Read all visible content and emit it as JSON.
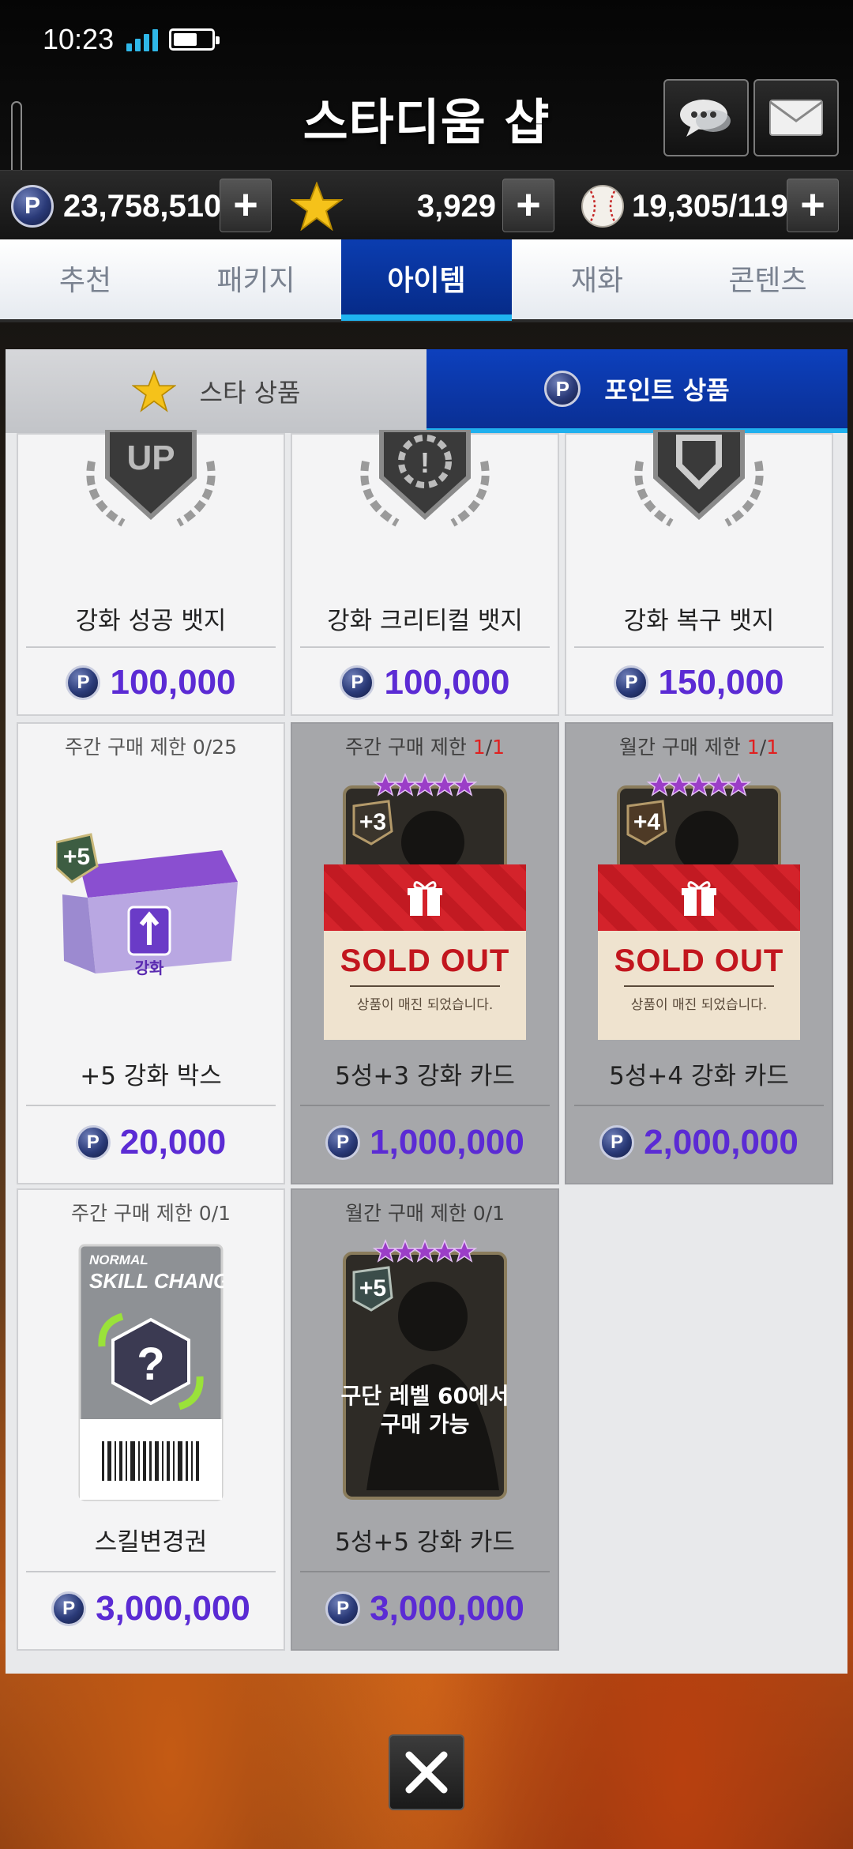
{
  "status_bar": {
    "time": "10:23"
  },
  "header": {
    "title": "스타디움 샵"
  },
  "currency": {
    "points": "23,758,510",
    "stars": "3,929",
    "baseballs": "19,305/119",
    "coin_symbol": "P"
  },
  "main_tabs": [
    {
      "label": "추천"
    },
    {
      "label": "패키지"
    },
    {
      "label": "아이템"
    },
    {
      "label": "재화"
    },
    {
      "label": "콘텐츠"
    }
  ],
  "sub_tabs": [
    {
      "label": "스타 상품"
    },
    {
      "label": "포인트 상품"
    }
  ],
  "items": [
    {
      "limit": "",
      "name": "강화 성공 뱃지",
      "price": "100,000",
      "art_label": "UP"
    },
    {
      "limit": "",
      "name": "강화 크리티컬 뱃지",
      "price": "100,000",
      "art_label": "!"
    },
    {
      "limit": "",
      "name": "강화 복구 뱃지",
      "price": "150,000",
      "art_label": ""
    },
    {
      "limit": "주간 구매 제한 0/25",
      "name": "+5 강화 박스",
      "price": "20,000",
      "art_label": "+5",
      "art_sub": "강화"
    },
    {
      "limit_prefix": "주간 구매 제한 ",
      "limit_a": "1",
      "limit_b": "1",
      "name": "5성+3 강화 카드",
      "price": "1,000,000",
      "art_label": "+3",
      "sold_title": "SOLD OUT",
      "sold_desc": "상품이 매진 되었습니다."
    },
    {
      "limit_prefix": "월간 구매 제한 ",
      "limit_a": "1",
      "limit_b": "1",
      "name": "5성+4 강화 카드",
      "price": "2,000,000",
      "art_label": "+4",
      "sold_title": "SOLD OUT",
      "sold_desc": "상품이 매진 되었습니다."
    },
    {
      "limit": "주간 구매 제한 0/1",
      "name": "스킬변경권",
      "price": "3,000,000",
      "art_top1": "NORMAL",
      "art_top2": "SKILL CHANGE",
      "art_q": "?"
    },
    {
      "limit": "월간 구매 제한 0/1",
      "name": "5성+5 강화 카드",
      "price": "3,000,000",
      "art_label": "+5",
      "lock_text_1": "구단 레벨 60에서",
      "lock_text_2": "구매 가능"
    }
  ],
  "colors": {
    "accent_blue": "#0a35a6",
    "price_purple": "#5b2bd4",
    "limit_red": "#e02020",
    "tab_highlight": "#1fb4f0"
  }
}
